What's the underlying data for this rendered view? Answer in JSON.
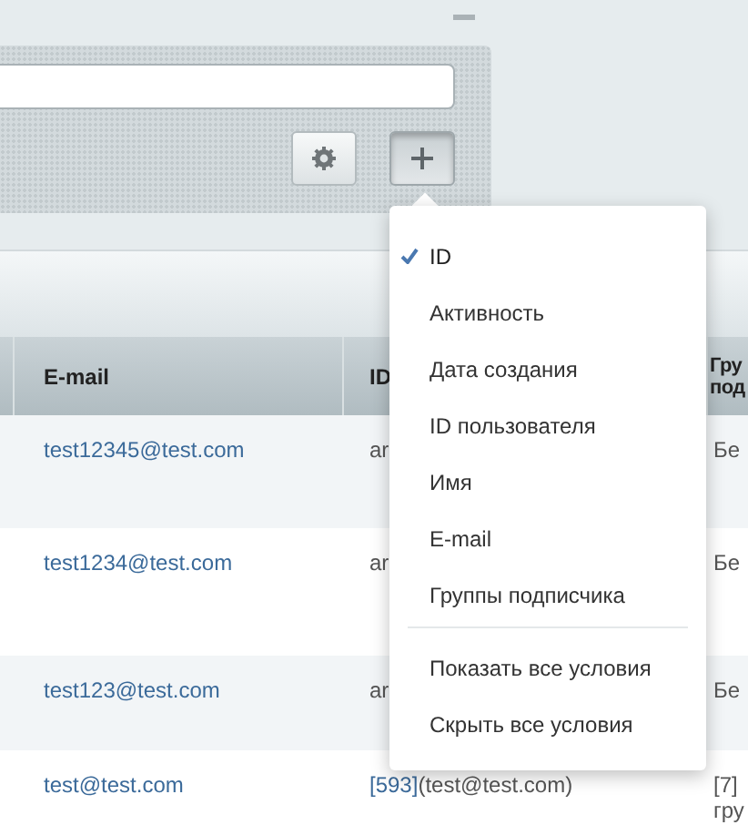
{
  "menu": {
    "fields": [
      {
        "label": "ID",
        "checked": true
      },
      {
        "label": "Активность",
        "checked": false
      },
      {
        "label": "Дата создания",
        "checked": false
      },
      {
        "label": "ID пользователя",
        "checked": false
      },
      {
        "label": "Имя",
        "checked": false
      },
      {
        "label": "E-mail",
        "checked": false
      },
      {
        "label": "Группы подписчика",
        "checked": false
      }
    ],
    "actions": [
      "Показать все условия",
      "Скрыть все условия"
    ]
  },
  "table": {
    "columns": [
      "E-mail",
      "ID",
      "Гру под"
    ],
    "rows": [
      {
        "email": "test12345@test.com",
        "user": {
          "text": "ar"
        },
        "groups": "Бе"
      },
      {
        "email": "test1234@test.com",
        "user": {
          "text": "ar"
        },
        "groups": "Бе"
      },
      {
        "email": "test123@test.com",
        "user": {
          "text": "ar"
        },
        "groups": "Бе"
      },
      {
        "email": "test@test.com",
        "user": {
          "link": "[593]",
          "text": "(test@test.com)"
        },
        "groups": "[7] гру"
      }
    ]
  }
}
